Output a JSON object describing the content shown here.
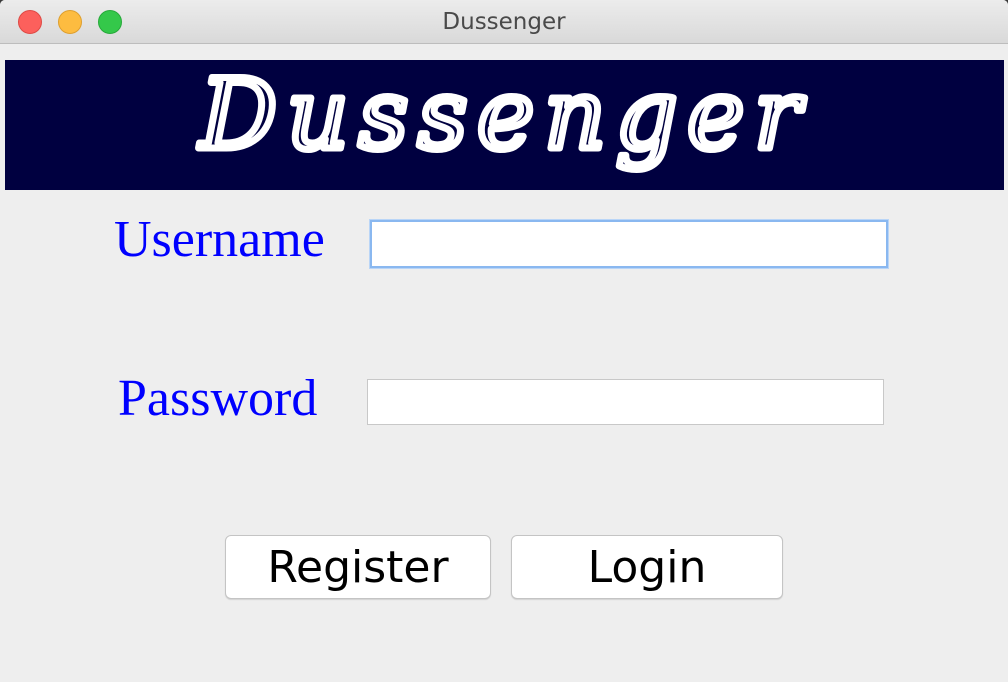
{
  "window": {
    "title": "Dussenger"
  },
  "banner": {
    "logo_text": "Dussenger"
  },
  "form": {
    "username_label": "Username",
    "username_value": "",
    "password_label": "Password",
    "password_value": ""
  },
  "buttons": {
    "register_label": "Register",
    "login_label": "Login"
  },
  "colors": {
    "banner_background": "#000040",
    "label_color": "#0000ff",
    "focus_ring": "#8ab8f0"
  }
}
